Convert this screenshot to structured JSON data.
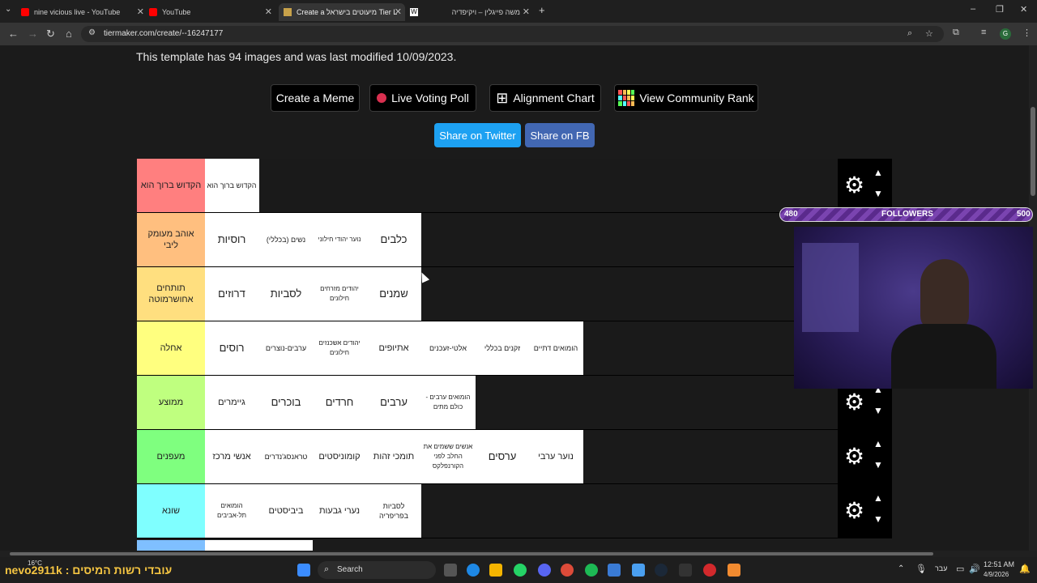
{
  "tabs": [
    {
      "title": "nine vicious live - YouTube",
      "icon": "youtube-icon"
    },
    {
      "title": "YouTube",
      "icon": "youtube-icon"
    },
    {
      "title": "Create a מיעוטים בישראל Tier L",
      "icon": "tiermaker-icon"
    },
    {
      "title": "",
      "icon": "wikipedia-icon"
    },
    {
      "title": "משה פייגלין – ויקיפדיה",
      "icon": "wikipedia-icon"
    }
  ],
  "window_controls": {
    "minimize": "–",
    "maximize": "❐",
    "close": "✕"
  },
  "address": {
    "url": "tiermaker.com/create/--16247177"
  },
  "page": {
    "info": "This template has 94 images and was last modified 10/09/2023.",
    "buttons": {
      "meme": "Create a Meme",
      "poll": "Live Voting Poll",
      "alignment": "Alignment Chart",
      "community": "View Community Rank"
    },
    "share": {
      "twitter": "Share on Twitter",
      "fb": "Share on FB"
    }
  },
  "tiers": [
    {
      "label": "הקדוש ברוך הוא",
      "color": "#ff7f7f",
      "items": [
        "הקדוש ברוך הוא"
      ]
    },
    {
      "label": "אוהב מעומק ליבי",
      "color": "#ffbf7f",
      "items": [
        "רוסיות",
        "נשים (בכללי)",
        "נוער יהודי חילוני",
        "כלבים"
      ]
    },
    {
      "label": "תותחים אחושרמוטה",
      "color": "#ffdf7f",
      "items": [
        "דרוזים",
        "לסביות",
        "יהודים מזרחים חילונים",
        "שמנים"
      ]
    },
    {
      "label": "אחלה",
      "color": "#ffff7f",
      "items": [
        "רוסים",
        "ערבים-נוצרים",
        "יהודים אשכנזים חילונים",
        "אתיופים",
        "אלטי-זעכנים",
        "זקנים בכללי",
        "הומואים דתיים"
      ]
    },
    {
      "label": "ממוצע",
      "color": "#bfff7f",
      "items": [
        "גיימרים",
        "בוכרים",
        "חרדים",
        "ערבים",
        "הומואים ערבים -כולם מתים"
      ]
    },
    {
      "label": "מעפנים",
      "color": "#7fff7f",
      "items": [
        "אנשי מרכז",
        "טראנסג'נדרים",
        "קומוניסטים",
        "תומכי זהות",
        "אנשים ששמים את החלב לפני הקורנפלקס",
        "ערסים",
        "נוער ערבי"
      ]
    },
    {
      "label": "שונא",
      "color": "#7fffff",
      "items": [
        "הומואים תל-אביבים",
        "ביביסטים",
        "נערי גבעות",
        "לסביות בפריפריה"
      ]
    }
  ],
  "overlay": {
    "followers_left": "480",
    "followers_label": "FOLLOWERS",
    "followers_right": "500",
    "stream_ticker": "עובדי רשות המיסים : nevo2911k"
  },
  "taskbar": {
    "weather": "16°C",
    "search": "Search",
    "lang": "עבר",
    "time": "12:51 AM",
    "date": "4/9/2026"
  }
}
